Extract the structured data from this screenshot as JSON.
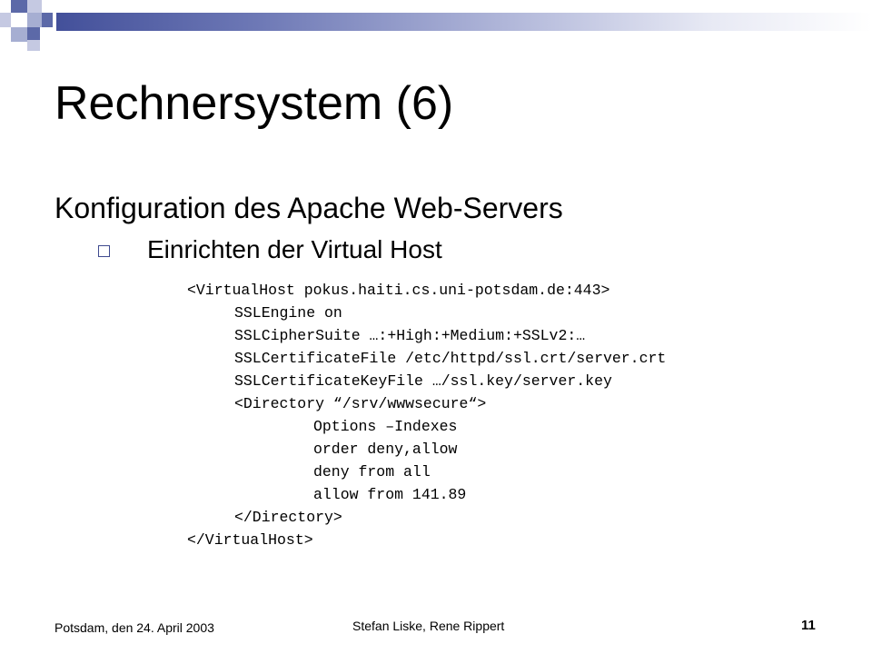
{
  "slide": {
    "title": "Rechnersystem (6)",
    "subtitle": "Konfiguration des Apache Web-Servers",
    "bullet": "Einrichten der Virtual Host",
    "code_lines": [
      "<VirtualHost pokus.haiti.cs.uni-potsdam.de:443>",
      "SSLEngine on",
      "SSLCipherSuite …:+High:+Medium:+SSLv2:…",
      "SSLCertificateFile /etc/httpd/ssl.crt/server.crt",
      "SSLCertificateKeyFile …/ssl.key/server.key",
      "<Directory “/srv/wwwsecure“>",
      "Options –Indexes",
      "order deny,allow",
      "deny from all",
      "allow from 141.89",
      "</Directory>",
      "</VirtualHost>"
    ]
  },
  "footer": {
    "date": "Potsdam, den 24. April 2003",
    "authors": "Stefan Liske, Rene Rippert",
    "page_number": "11"
  },
  "colors": {
    "accent_dark": "#43509a",
    "accent_light": "#c5c9e2"
  }
}
